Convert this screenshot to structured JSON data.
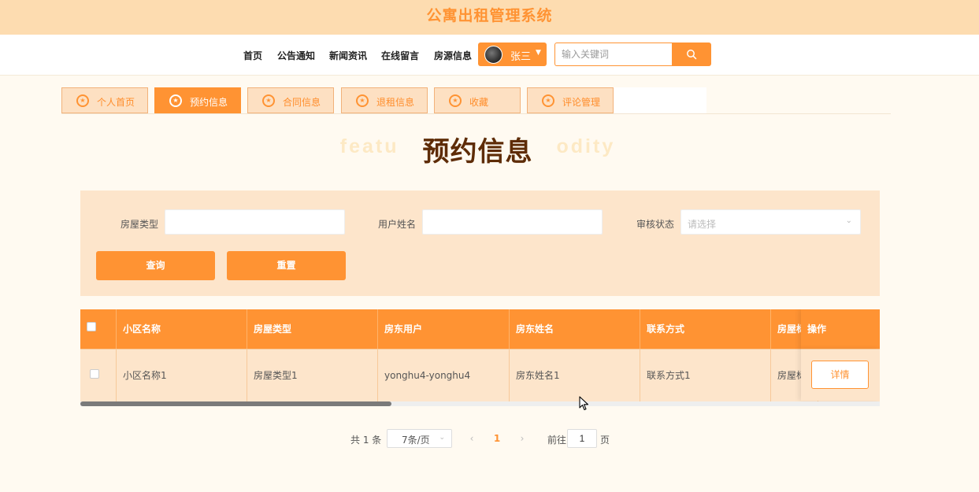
{
  "app": {
    "title": "公寓出租管理系统"
  },
  "nav": {
    "items": [
      {
        "label": "首页"
      },
      {
        "label": "公告通知"
      },
      {
        "label": "新闻资讯"
      },
      {
        "label": "在线留言"
      },
      {
        "label": "房源信息"
      }
    ],
    "user": {
      "name": "张三",
      "avatar_icon": "avatar",
      "menu_icon": "caret-down-icon"
    },
    "search": {
      "placeholder": "输入关键词",
      "value": "",
      "icon": "search-icon"
    }
  },
  "tabs": [
    {
      "label": "个人首页",
      "icon": "star-circle-icon",
      "active": false
    },
    {
      "label": "预约信息",
      "icon": "star-circle-icon",
      "active": true
    },
    {
      "label": "合同信息",
      "icon": "star-circle-icon",
      "active": false
    },
    {
      "label": "退租信息",
      "icon": "star-circle-icon",
      "active": false
    },
    {
      "label": "收藏",
      "icon": "star-circle-icon",
      "active": false
    },
    {
      "label": "评论管理",
      "icon": "star-circle-icon",
      "active": false
    }
  ],
  "page": {
    "ghost_text": "featu",
    "ghost_text_right": "odity",
    "title": "预约信息"
  },
  "filters": {
    "house_type": {
      "label": "房屋类型",
      "value": ""
    },
    "user_name": {
      "label": "用户姓名",
      "value": ""
    },
    "review_status": {
      "label": "审核状态",
      "placeholder": "请选择"
    },
    "query_label": "查询",
    "reset_label": "重置"
  },
  "table": {
    "columns": [
      "小区名称",
      "房屋类型",
      "房东用户",
      "房东姓名",
      "联系方式",
      "房屋标"
    ],
    "action_column": "操作",
    "rows": [
      {
        "cells": [
          "小区名称1",
          "房屋类型1",
          "yonghu4-yonghu4",
          "房东姓名1",
          "联系方式1",
          "房屋标"
        ],
        "action_label": "详情"
      }
    ]
  },
  "pagination": {
    "total_text": "共 1 条",
    "page_size": "7条/页",
    "current_page": "1",
    "goto_label": "前往",
    "goto_value": "1",
    "page_suffix": "页"
  },
  "colors": {
    "accent": "#ff9333",
    "header_bg": "#fddcb0",
    "panel_bg": "#fde5cb",
    "title_color": "#5e2c07"
  }
}
